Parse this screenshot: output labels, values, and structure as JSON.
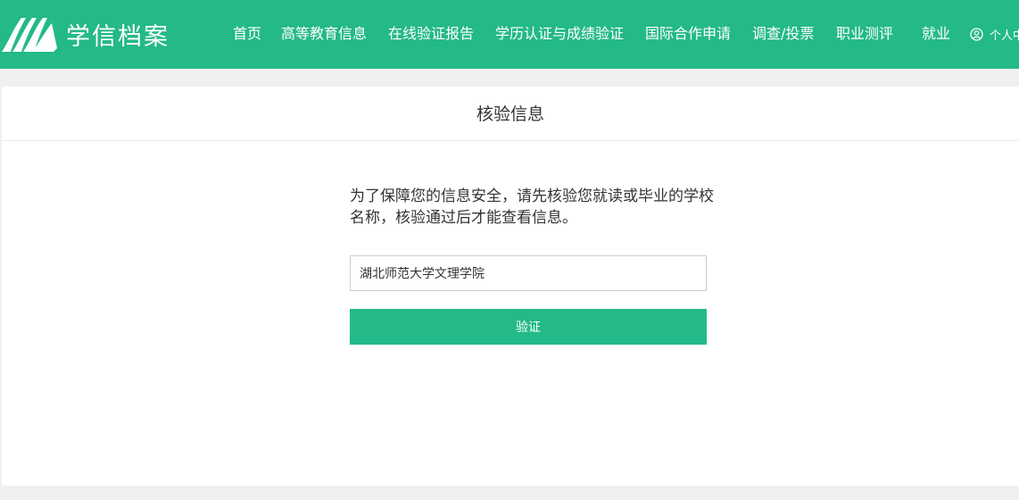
{
  "header": {
    "logo_text": "学信档案",
    "nav": [
      {
        "label": "首页"
      },
      {
        "label": "高等教育信息"
      },
      {
        "label": "在线验证报告"
      },
      {
        "label": "学历认证与成绩验证"
      },
      {
        "label": "国际合作申请"
      },
      {
        "label": "调查/投票"
      },
      {
        "label": "职业测评"
      },
      {
        "label": "就业"
      }
    ],
    "user_label": "个人中心",
    "icons": {
      "logo": "book-pages-logo",
      "user": "user-circle-icon"
    },
    "colors": {
      "brand": "#24b989",
      "text_on_brand": "#ffffff"
    }
  },
  "main": {
    "title": "核验信息",
    "notice": "为了保障您的信息安全，请先核验您就读或毕业的学校名称，核验通过后才能查看信息。",
    "school_input": {
      "value": "湖北师范大学文理学院",
      "placeholder": ""
    },
    "verify_label": "验证"
  }
}
